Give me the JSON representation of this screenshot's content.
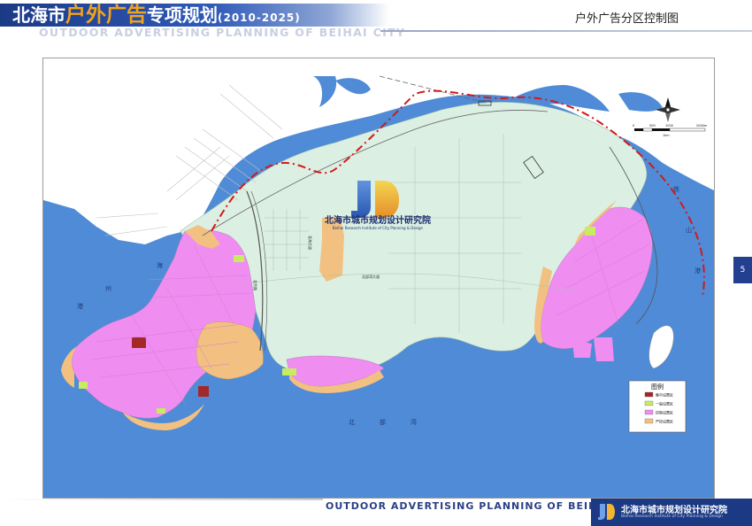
{
  "header": {
    "title_prefix": "北海市",
    "title_highlight": "户外广告",
    "title_suffix": "专项规划",
    "title_years": "(2010-2025)",
    "subtitle_en": "OUTDOOR  ADVERTISING PLANNING OF BEIHAI CITY",
    "section_title": "户外广告分区控制图"
  },
  "map": {
    "watermark_cn": "北海市城市规划设计研究院",
    "watermark_en": "Beihai Research Institute of City Planning & Design",
    "water_labels": [
      "海",
      "州",
      "港",
      "北",
      "部",
      "湾",
      "铁",
      "山",
      "港"
    ],
    "road_labels": [
      "北京路",
      "北部湾大道",
      "北海大道"
    ],
    "scale": {
      "labels": [
        "0",
        "500",
        "1000",
        "2000m"
      ],
      "unit_note": "1km"
    },
    "legend": {
      "title": "图例",
      "items": [
        {
          "label": "集中设置区",
          "color": "#a52828"
        },
        {
          "label": "一般设置区",
          "color": "#c7ec62"
        },
        {
          "label": "控制设置区",
          "color": "#ef8df0"
        },
        {
          "label": "严控设置区",
          "color": "#f2c080"
        }
      ]
    },
    "colors": {
      "sea": "#4f8bd6",
      "land": "#ffffff",
      "planning_area": "#dcefe3",
      "boundary": "#d11a1a"
    }
  },
  "page_number": "5",
  "footer": {
    "text_en": "OUTDOOR  ADVERTISING PLANNING OF BEIHAI CITY",
    "org_cn": "北海市城市规划设计研究院",
    "org_en": "Beihai Research Institute of City Planning & Design"
  }
}
